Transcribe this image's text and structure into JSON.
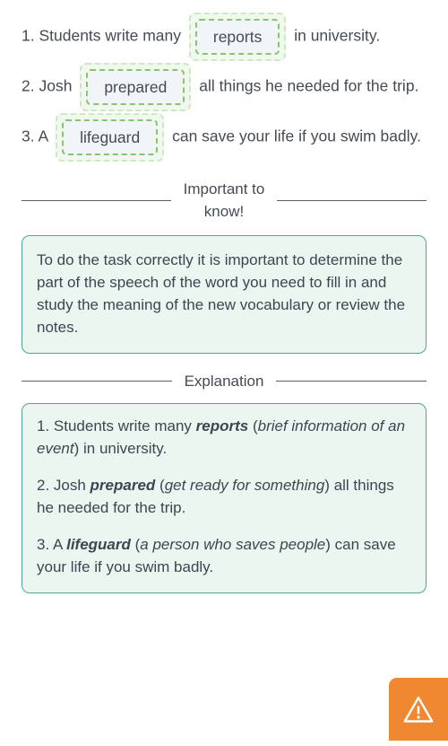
{
  "task": {
    "items": [
      {
        "before": "1. Students write many",
        "answer": "reports",
        "after": "in university."
      },
      {
        "before": "2. Josh",
        "answer": "prepared",
        "after": "all things he needed for the trip."
      },
      {
        "before": "3. A",
        "answer": "lifeguard",
        "after": "can save your life if you swim badly."
      }
    ]
  },
  "important": {
    "divider_label": "Important to\nknow!",
    "text": "To do the task correctly it is important to determine the part of the speech of the word you need to fill in and study the meaning of the new vocabulary or review the notes."
  },
  "explanation": {
    "divider_label": "Explanation",
    "items": [
      {
        "lead": "1. Students write many ",
        "keyword": "reports",
        "open_paren": " (",
        "definition": "brief information of an event",
        "close_paren": ") ",
        "tail": "in university."
      },
      {
        "lead": "2. Josh ",
        "keyword": "prepared",
        "open_paren": " (",
        "definition": "get ready for something",
        "close_paren": ") ",
        "tail": "all things he needed for the trip."
      },
      {
        "lead": "3. A ",
        "keyword": "lifeguard",
        "open_paren": " (",
        "definition": "a person who saves people",
        "close_paren": ") ",
        "tail": "can save your life if you swim badly."
      }
    ]
  },
  "warning_button": {
    "icon": "warning-triangle-icon",
    "color": "#f08832"
  }
}
